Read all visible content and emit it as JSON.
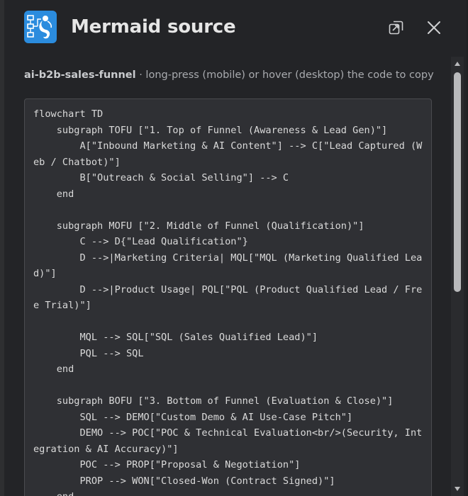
{
  "dialog": {
    "title": "Mermaid source",
    "icon": "mermaid-app-icon",
    "actions": {
      "open_icon": "open-in-new-window-icon",
      "close_icon": "close-icon"
    }
  },
  "source": {
    "name": "ai-b2b-sales-funnel",
    "hint": " · long-press (mobile) or hover (desktop) the code to copy"
  },
  "code": "flowchart TD\n    subgraph TOFU [\"1. Top of Funnel (Awareness & Lead Gen)\"]\n        A[\"Inbound Marketing & AI Content\"] --> C[\"Lead Captured (Web / Chatbot)\"]\n        B[\"Outreach & Social Selling\"] --> C\n    end\n\n    subgraph MOFU [\"2. Middle of Funnel (Qualification)\"]\n        C --> D{\"Lead Qualification\"}\n        D -->|Marketing Criteria| MQL[\"MQL (Marketing Qualified Lead)\"]\n        D -->|Product Usage| PQL[\"PQL (Product Qualified Lead / Free Trial)\"]\n\n        MQL --> SQL[\"SQL (Sales Qualified Lead)\"]\n        PQL --> SQL\n    end\n\n    subgraph BOFU [\"3. Bottom of Funnel (Evaluation & Close)\"]\n        SQL --> DEMO[\"Custom Demo & AI Use-Case Pitch\"]\n        DEMO --> POC[\"POC & Technical Evaluation<br/>(Security, Integration & AI Accuracy)\"]\n        POC --> PROP[\"Proposal & Negotiation\"]\n        PROP --> WON[\"Closed-Won (Contract Signed)\"]\n    end",
  "colors": {
    "dialog_bg": "#232427",
    "code_bg": "#2f3034",
    "icon_bg": "#2b8cde",
    "text": "#dadada"
  }
}
